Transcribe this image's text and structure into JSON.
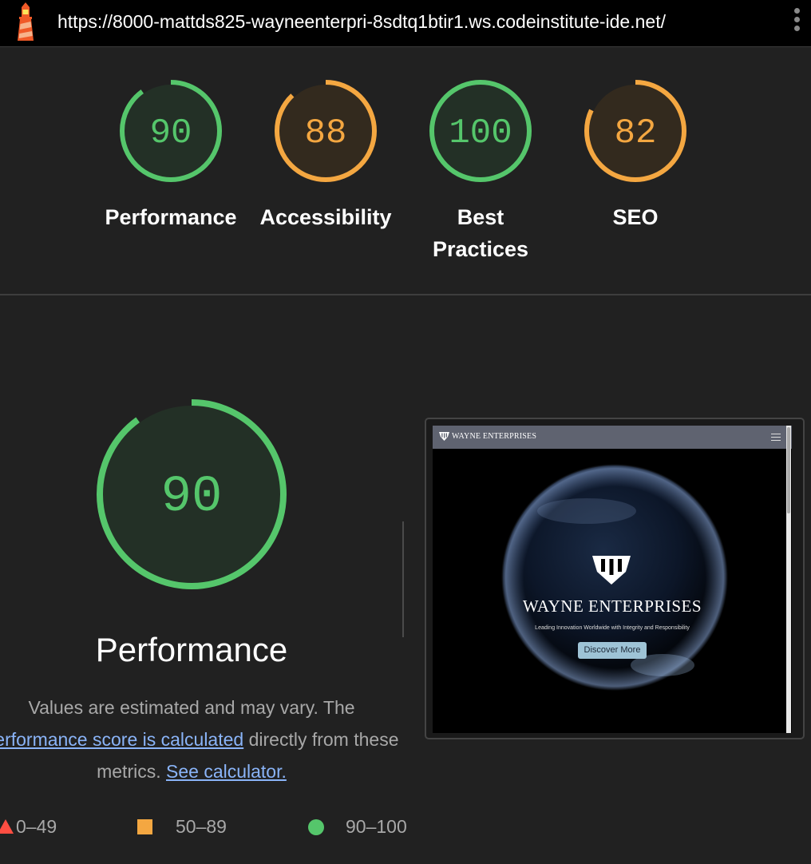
{
  "browser": {
    "url": "https://8000-mattds825-wayneenterpri-8sdtq1btir1.ws.codeinstitute-ide.net/"
  },
  "scores": [
    {
      "label": "Performance",
      "value": "90",
      "score": 90,
      "color": "#55c66b"
    },
    {
      "label": "Accessibility",
      "value": "88",
      "score": 88,
      "color": "#f4a741"
    },
    {
      "label": "Best Practices",
      "value": "100",
      "score": 100,
      "color": "#55c66b"
    },
    {
      "label": "SEO",
      "value": "82",
      "score": 82,
      "color": "#f4a741"
    }
  ],
  "performance": {
    "score": "90",
    "score_value": 90,
    "title": "Performance",
    "desc_pre": "Values are estimated and may vary. The",
    "desc_link": "performance score is calculated",
    "desc_mid": "directly from these metrics.",
    "desc_link2": "See calculator."
  },
  "screenshot": {
    "brand": "WAYNE ENTERPRISES",
    "hero_title": "WAYNE ENTERPRISES",
    "hero_subtitle": "Leading Innovation Worldwide with Integrity and Responsibility",
    "hero_button": "Discover More"
  },
  "legend": [
    {
      "range": "0–49",
      "color": "#ff4e42"
    },
    {
      "range": "50–89",
      "color": "#f4a741"
    },
    {
      "range": "90–100",
      "color": "#55c66b"
    }
  ],
  "colors": {
    "pass": "#55c66b",
    "average": "#f4a741",
    "fail": "#ff4e42",
    "link": "#8ab4f8",
    "background": "#212121"
  }
}
